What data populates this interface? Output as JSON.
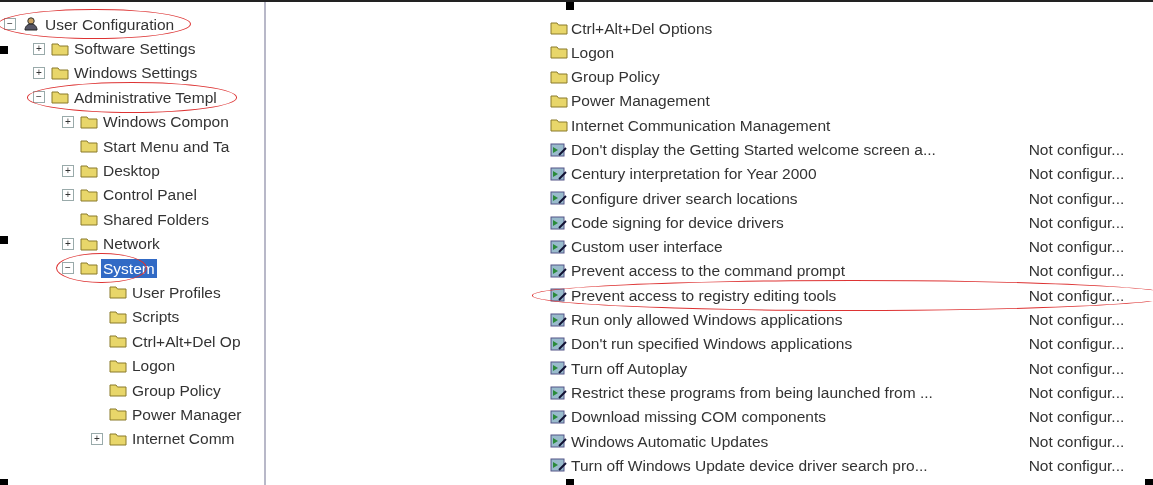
{
  "tree": [
    {
      "label": "User Configuration",
      "kind": "user",
      "expander": "−",
      "selected": false,
      "circled": true,
      "children": [
        {
          "label": "Software Settings",
          "kind": "folder",
          "expander": "+",
          "selected": false,
          "circled": false
        },
        {
          "label": "Windows Settings",
          "kind": "folder",
          "expander": "+",
          "selected": false,
          "circled": false
        },
        {
          "label": "Administrative Templ",
          "kind": "folder",
          "expander": "−",
          "selected": false,
          "circled": true,
          "children": [
            {
              "label": "Windows Compon",
              "kind": "folder",
              "expander": "+",
              "selected": false,
              "circled": false
            },
            {
              "label": "Start Menu and Ta",
              "kind": "folder",
              "selected": false,
              "circled": false
            },
            {
              "label": "Desktop",
              "kind": "folder",
              "expander": "+",
              "selected": false,
              "circled": false
            },
            {
              "label": "Control Panel",
              "kind": "folder",
              "expander": "+",
              "selected": false,
              "circled": false
            },
            {
              "label": "Shared Folders",
              "kind": "folder",
              "selected": false,
              "circled": false
            },
            {
              "label": "Network",
              "kind": "folder",
              "expander": "+",
              "selected": false,
              "circled": false
            },
            {
              "label": "System",
              "kind": "folder",
              "expander": "−",
              "selected": true,
              "circled": true,
              "children": [
                {
                  "label": "User Profiles",
                  "kind": "folder",
                  "selected": false,
                  "circled": false
                },
                {
                  "label": "Scripts",
                  "kind": "folder",
                  "selected": false,
                  "circled": false
                },
                {
                  "label": "Ctrl+Alt+Del Op",
                  "kind": "folder",
                  "selected": false,
                  "circled": false
                },
                {
                  "label": "Logon",
                  "kind": "folder",
                  "selected": false,
                  "circled": false
                },
                {
                  "label": "Group Policy",
                  "kind": "folder",
                  "selected": false,
                  "circled": false
                },
                {
                  "label": "Power Manager",
                  "kind": "folder",
                  "selected": false,
                  "circled": false
                },
                {
                  "label": "Internet Comm",
                  "kind": "folder",
                  "expander": "+",
                  "selected": false,
                  "circled": false
                }
              ]
            }
          ]
        }
      ]
    }
  ],
  "list": [
    {
      "kind": "folder",
      "name": "Ctrl+Alt+Del Options",
      "circled": false
    },
    {
      "kind": "folder",
      "name": "Logon",
      "circled": false
    },
    {
      "kind": "folder",
      "name": "Group Policy",
      "circled": false
    },
    {
      "kind": "folder",
      "name": "Power Management",
      "circled": false
    },
    {
      "kind": "folder",
      "name": "Internet Communication Management",
      "circled": false
    },
    {
      "kind": "setting",
      "name": "Don't display the Getting Started welcome screen a...",
      "state": "Not configur...",
      "circled": false
    },
    {
      "kind": "setting",
      "name": "Century interpretation for Year 2000",
      "state": "Not configur...",
      "circled": false
    },
    {
      "kind": "setting",
      "name": "Configure driver search locations",
      "state": "Not configur...",
      "circled": false
    },
    {
      "kind": "setting",
      "name": "Code signing for device drivers",
      "state": "Not configur...",
      "circled": false
    },
    {
      "kind": "setting",
      "name": "Custom user interface",
      "state": "Not configur...",
      "circled": false
    },
    {
      "kind": "setting",
      "name": "Prevent access to the command prompt",
      "state": "Not configur...",
      "circled": false
    },
    {
      "kind": "setting",
      "name": "Prevent access to registry editing tools",
      "state": "Not configur...",
      "circled": true
    },
    {
      "kind": "setting",
      "name": "Run only allowed Windows applications",
      "state": "Not configur...",
      "circled": false
    },
    {
      "kind": "setting",
      "name": "Don't run specified Windows applications",
      "state": "Not configur...",
      "circled": false
    },
    {
      "kind": "setting",
      "name": "Turn off Autoplay",
      "state": "Not configur...",
      "circled": false
    },
    {
      "kind": "setting",
      "name": "Restrict these programs from being launched from ...",
      "state": "Not configur...",
      "circled": false
    },
    {
      "kind": "setting",
      "name": "Download missing COM components",
      "state": "Not configur...",
      "circled": false
    },
    {
      "kind": "setting",
      "name": "Windows Automatic Updates",
      "state": "Not configur...",
      "circled": false
    },
    {
      "kind": "setting",
      "name": "Turn off Windows Update device driver search pro...",
      "state": "Not configur...",
      "circled": false
    }
  ]
}
